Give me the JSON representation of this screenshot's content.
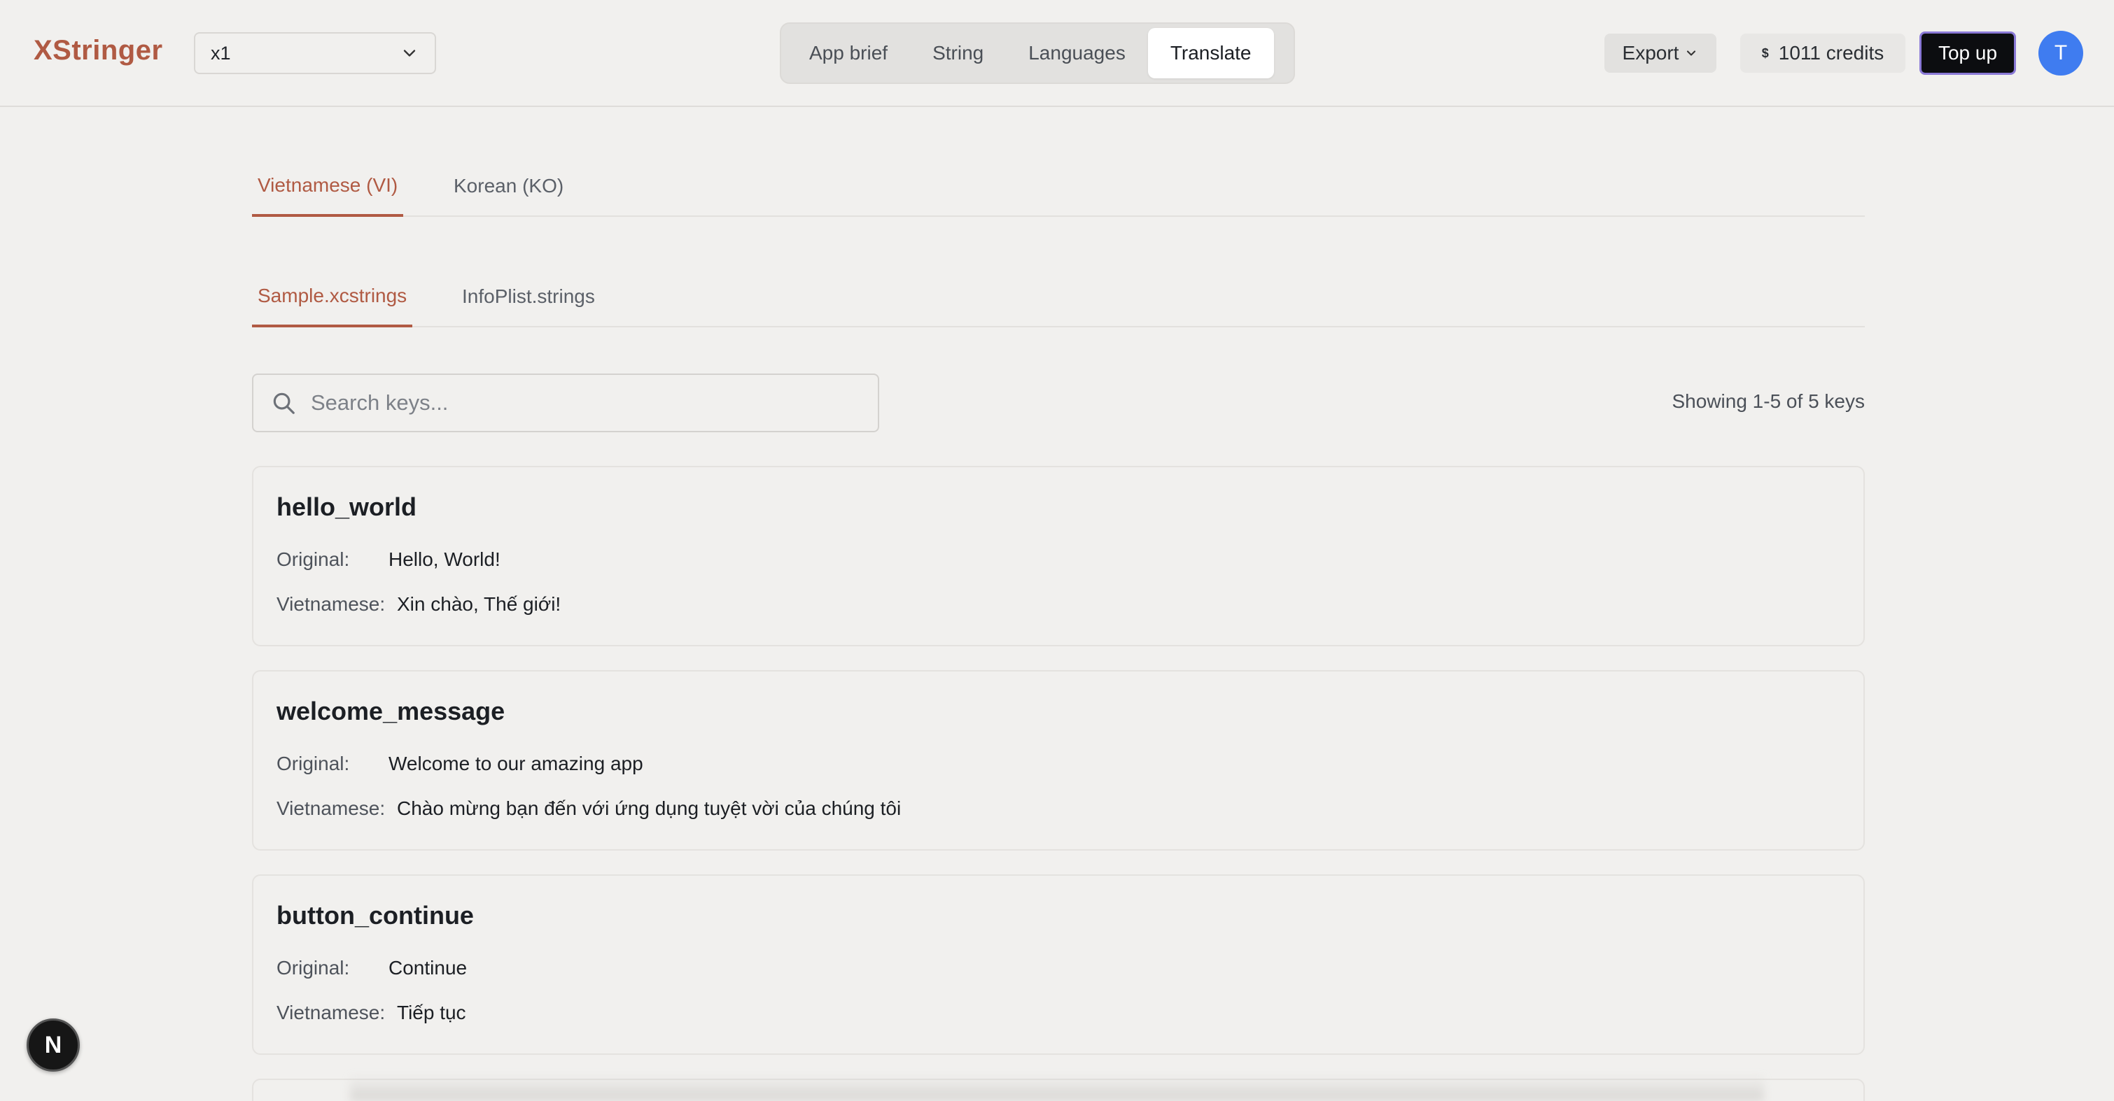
{
  "app": {
    "logo": "XStringer"
  },
  "project_select": {
    "value": "x1"
  },
  "nav": {
    "tabs": [
      {
        "label": "App brief",
        "active": false
      },
      {
        "label": "String",
        "active": false
      },
      {
        "label": "Languages",
        "active": false
      },
      {
        "label": "Translate",
        "active": true
      }
    ]
  },
  "header_actions": {
    "export_label": "Export",
    "credits_symbol": "$",
    "credits_text": "1011 credits",
    "topup_label": "Top up",
    "avatar_initial": "T"
  },
  "language_tabs": [
    {
      "label": "Vietnamese (VI)",
      "active": true
    },
    {
      "label": "Korean (KO)",
      "active": false
    }
  ],
  "file_tabs": [
    {
      "label": "Sample.xcstrings",
      "active": true
    },
    {
      "label": "InfoPlist.strings",
      "active": false
    }
  ],
  "search": {
    "placeholder": "Search keys...",
    "value": ""
  },
  "showing_text": "Showing 1-5 of 5 keys",
  "labels": {
    "original": "Original:",
    "translated": "Vietnamese:"
  },
  "entries": [
    {
      "key": "hello_world",
      "original": "Hello, World!",
      "translation": "Xin chào, Thế giới!"
    },
    {
      "key": "welcome_message",
      "original": "Welcome to our amazing app",
      "translation": "Chào mừng bạn đến với ứng dụng tuyệt vời của chúng tôi"
    },
    {
      "key": "button_continue",
      "original": "Continue",
      "translation": "Tiếp tục"
    }
  ],
  "dev_badge": {
    "letter": "N"
  },
  "colors": {
    "accent": "#b05a43",
    "avatar": "#3f7cf0",
    "topup_bg": "#0c0d10",
    "topup_border": "#8a79d6"
  },
  "icons": {
    "select": "chevron-down-icon",
    "search": "search-icon",
    "export": "chevron-down-icon"
  }
}
